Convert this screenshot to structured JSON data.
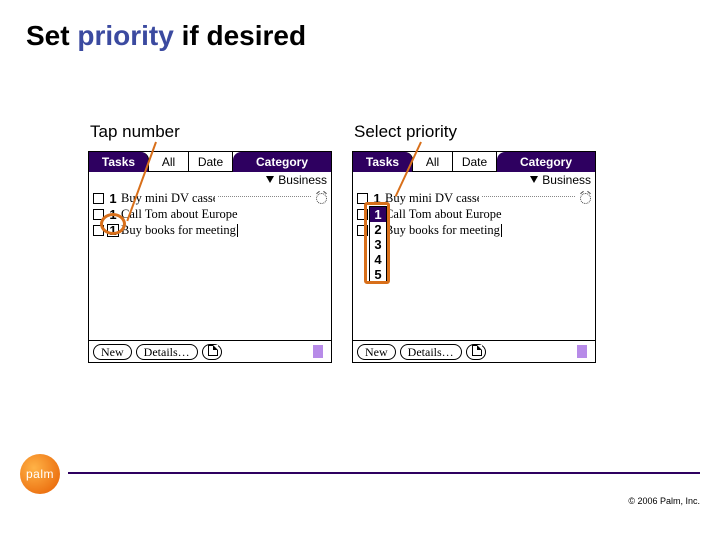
{
  "title_pre": "Set ",
  "title_accent": "priority",
  "title_post": " if desired",
  "captions": {
    "left": "Tap number",
    "right": "Select priority"
  },
  "tabs": {
    "tasks": "Tasks",
    "all": "All",
    "date": "Date",
    "category": "Category"
  },
  "filter": "Business",
  "tasks_list": [
    {
      "priority": "1",
      "text": "Buy mini DV cassettes",
      "alarm": true
    },
    {
      "priority": "1",
      "text": "Call Tom about Europe",
      "alarm": false
    },
    {
      "priority": "1",
      "text": "Buy books for meeting",
      "alarm": false,
      "boxedLeft": true
    }
  ],
  "priority_options": [
    "1",
    "2",
    "3",
    "4",
    "5"
  ],
  "buttons": {
    "new": "New",
    "details": "Details…"
  },
  "logo_text": "palm",
  "copyright": "© 2006 Palm, Inc."
}
